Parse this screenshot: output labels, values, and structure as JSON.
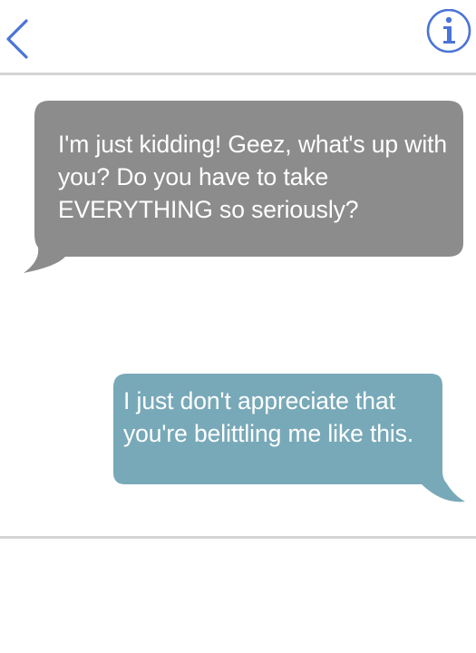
{
  "header": {
    "back_icon": "chevron-left-icon",
    "info_icon": "info-circle-icon",
    "accent_color": "#4a74d6"
  },
  "colors": {
    "received_bubble": "#8c8c8c",
    "sent_bubble": "#78a9b8",
    "divider": "#d4d4d4"
  },
  "messages": [
    {
      "direction": "received",
      "text": "I'm just kidding! Geez, what's up with you? Do you have to take EVERYTHING so seriously?"
    },
    {
      "direction": "sent",
      "text": "I just don't appreciate that you're belittling me like this."
    }
  ]
}
